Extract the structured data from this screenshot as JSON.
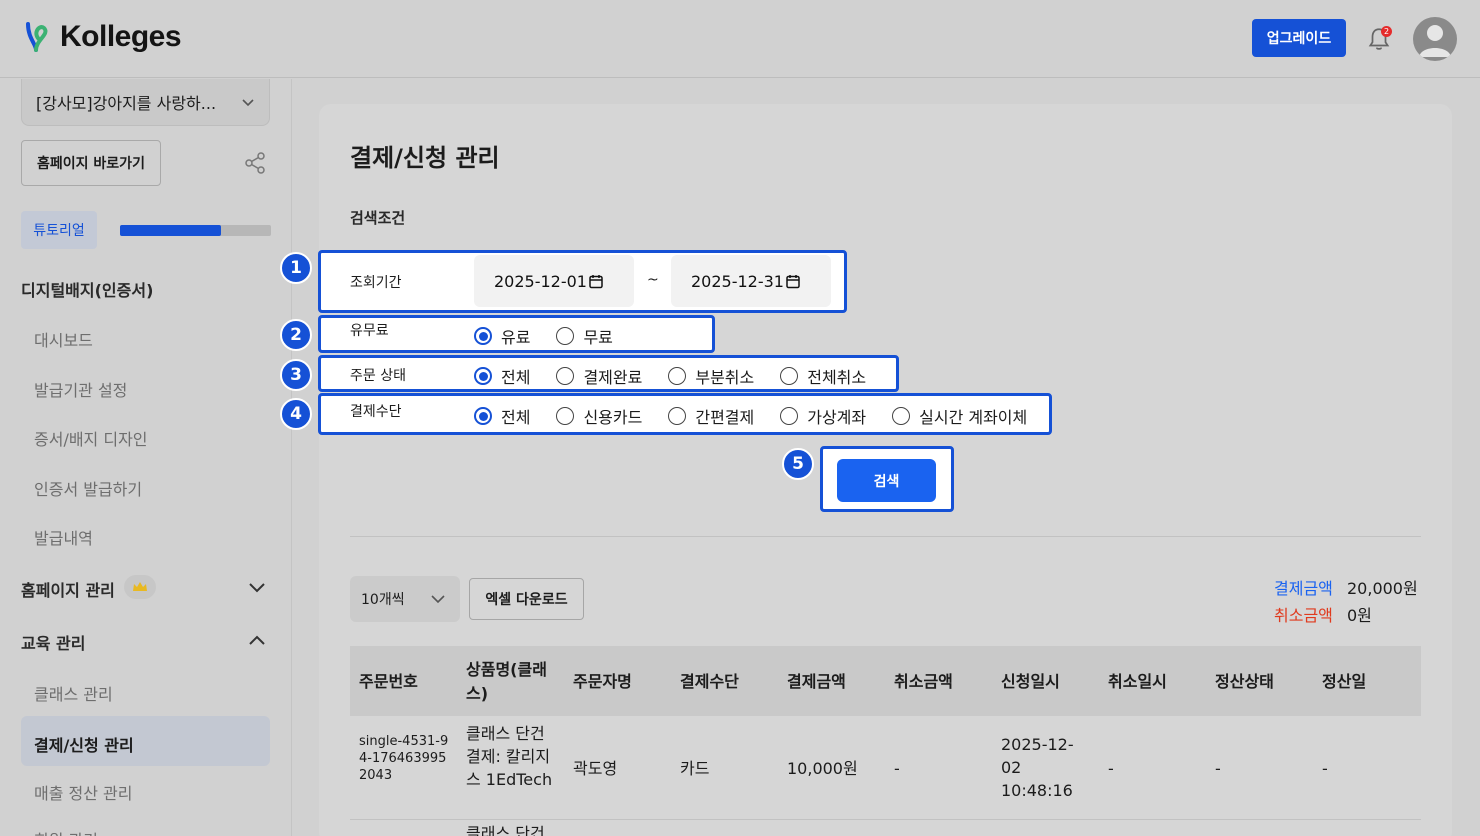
{
  "header": {
    "logo_text": "Kolleges",
    "upgrade_label": "업그레이드",
    "notification_count": "2"
  },
  "sidebar": {
    "org_name": "[강사모]강아지를 사랑하...",
    "home_button": "홈페이지 바로가기",
    "tutorial_label": "튜토리얼",
    "tutorial_progress": 0.67,
    "sections": [
      {
        "label": "디지털배지(인증서)",
        "items": [
          "대시보드",
          "발급기관 설정",
          "증서/배지 디자인",
          "인증서 발급하기",
          "발급내역"
        ]
      },
      {
        "label": "홈페이지 관리",
        "collapsed": true
      },
      {
        "label": "교육 관리",
        "items": [
          "클래스 관리",
          "결제/신청 관리",
          "매출 정산 관리",
          "회원 관리"
        ]
      }
    ],
    "active_item": "결제/신청 관리"
  },
  "main": {
    "title": "결제/신청 관리",
    "filter_title": "검색조건",
    "period": {
      "label": "조회기간",
      "start": "2025-12-01",
      "separator": "~",
      "end": "2025-12-31"
    },
    "paid": {
      "label": "유무료",
      "options": [
        "유료",
        "무료"
      ],
      "selected": "유료"
    },
    "order_status": {
      "label": "주문 상태",
      "options": [
        "전체",
        "결제완료",
        "부분취소",
        "전체취소"
      ],
      "selected": "전체"
    },
    "payment_method": {
      "label": "결제수단",
      "options": [
        "전체",
        "신용카드",
        "간편결제",
        "가상계좌",
        "실시간 계좌이체"
      ],
      "selected": "전체"
    },
    "search_button": "검색",
    "step_badges": [
      "1",
      "2",
      "3",
      "4",
      "5"
    ],
    "page_size": "10개씩",
    "excel_button": "엑셀 다운로드",
    "summary": {
      "paid_label": "결제금액",
      "paid_value": "20,000원",
      "paid_color": "#1a63f0",
      "cancel_label": "취소금액",
      "cancel_value": "0원",
      "cancel_color": "#e03a1e"
    },
    "table": {
      "columns": [
        "주문번호",
        "상품명(클래스)",
        "주문자명",
        "결제수단",
        "결제금액",
        "취소금액",
        "신청일시",
        "취소일시",
        "정산상태",
        "정산일"
      ],
      "rows": [
        {
          "order_no": "single-4531-94-1764639952043",
          "product": "클래스 단건결제: 칼리지스 1EdTech",
          "customer": "곽도영",
          "method": "카드",
          "amount": "10,000원",
          "cancel_amount": "-",
          "applied_at": "2025-12-02 10:48:16",
          "cancelled_at": "-",
          "settle_status": "-",
          "settle_date": "-"
        },
        {
          "product": "클래스 단건"
        }
      ]
    }
  },
  "colors": {
    "accent": "#1551d6",
    "button": "#1a63f0"
  }
}
